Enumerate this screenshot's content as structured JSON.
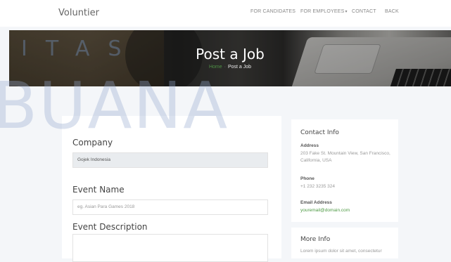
{
  "nav": {
    "brand": "Voluntier",
    "links": [
      "FOR CANDIDATES",
      "FOR EMPLOYEES",
      "CONTACT",
      "BACK"
    ]
  },
  "hero": {
    "title": "Post a Job",
    "breadcrumb_home": "Home",
    "breadcrumb_current": "Post a Job"
  },
  "watermark": {
    "top": "ITAS",
    "big": "BUANA"
  },
  "form": {
    "company_label": "Company",
    "company_value": "Gojek Indonesia",
    "event_name_label": "Event Name",
    "event_name_placeholder": "eg. Asian Para Games 2018",
    "event_description_label": "Event Description"
  },
  "contact": {
    "title": "Contact Info",
    "address_label": "Address",
    "address_value": "203 Fake St. Mountain View, San Francisco, California, USA",
    "phone_label": "Phone",
    "phone_value": "+1 232 3235 324",
    "email_label": "Email Address",
    "email_value": "youremail@domain.com"
  },
  "more_info": {
    "title": "More Info",
    "text": "Lorem ipsum dolor sit amet, consectetur"
  },
  "colors": {
    "accent": "#4e9a44",
    "hero_text": "#ffffff"
  }
}
